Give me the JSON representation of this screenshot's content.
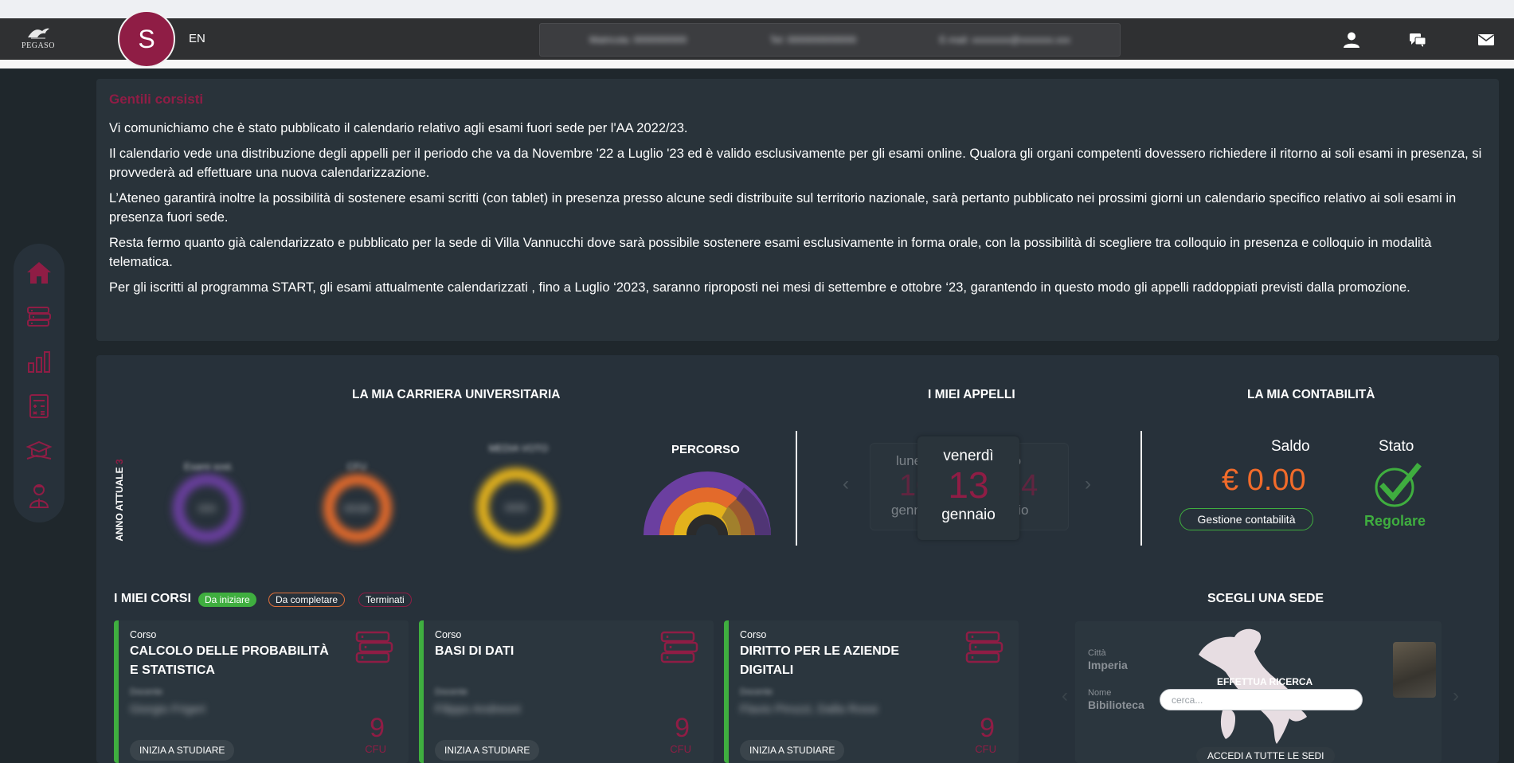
{
  "topbar": {
    "logo_text": "PEGASO",
    "avatar_initial": "S",
    "language": "EN",
    "contacts": [
      "Matricola: 0000000000",
      "Tel: 0000000000000",
      "E-mail: xxxxxxxx@xxxxxxx.xxx"
    ],
    "icons": [
      "user-icon",
      "chat-icon",
      "mail-icon"
    ]
  },
  "notice": {
    "title": "Gentili corsisti",
    "paragraphs": [
      "Vi comunichiamo che è stato pubblicato il calendario relativo agli esami fuori sede per l'AA 2022/23.",
      "Il calendario vede una distribuzione degli appelli per il periodo che va da Novembre '22 a Luglio '23 ed è valido esclusivamente per gli esami online. Qualora gli organi competenti dovessero richiedere il ritorno ai soli esami in presenza, si provvederà ad effettuare una nuova calendarizzazione.",
      "L’Ateneo garantirà inoltre la possibilità di sostenere esami scritti (con tablet) in presenza presso alcune sedi distribuite sul territorio nazionale, sarà pertanto pubblicato nei prossimi giorni un calendario specifico relativo ai soli esami in presenza fuori sede.",
      "Resta fermo quanto già calendarizzato e pubblicato per la sede di Villa Vannucchi dove sarà possibile sostenere esami esclusivamente in forma orale, con la possibilità di scegliere tra colloquio in presenza e colloquio in modalità telematica.",
      "Per gli iscritti al programma START, gli esami attualmente calendarizzati , fino a Luglio ‘2023, saranno riproposti nei mesi di settembre e ottobre ‘23, garantendo in questo modo gli appelli raddoppiati previsti dalla promozione."
    ]
  },
  "sidebar": {
    "items": [
      "home-icon",
      "books-icon",
      "stats-icon",
      "calculator-icon",
      "graduation-icon",
      "tutor-icon"
    ],
    "accent": "#8f1d45"
  },
  "carriera": {
    "title": "LA MIA CARRIERA UNIVERSITARIA",
    "anno_label": "ANNO ATTUALE",
    "anno_value": "3",
    "donuts": [
      {
        "label": "Esami sost.",
        "value": "0/24",
        "color": "#6b3fa0"
      },
      {
        "label": "CFU",
        "value": "00/180",
        "color": "#e36a2b"
      },
      {
        "label": "MEDIA VOTO",
        "value": "00/30",
        "color": "#e3b21c"
      }
    ],
    "percorso_title": "PERCORSO"
  },
  "appelli": {
    "title": "I MIEI APPELLI",
    "prev": {
      "dow": "lunedì",
      "day": "10",
      "month": "gennaio"
    },
    "current": {
      "dow": "venerdì",
      "day": "13",
      "month": "gennaio"
    },
    "next": {
      "dow": "sabato",
      "day": "14",
      "month": "gennaio"
    }
  },
  "contabilita": {
    "title": "LA MIA CONTABILITÀ",
    "saldo_label": "Saldo",
    "saldo_value": "€ 0.00",
    "gestione_button": "Gestione contabilità",
    "stato_label": "Stato",
    "stato_value": "Regolare"
  },
  "corsi": {
    "title": "I MIEI CORSI",
    "filters": [
      "Da iniziare",
      "Da completare",
      "Terminati"
    ],
    "items": [
      {
        "label": "Corso",
        "name": "CALCOLO DELLE PROBABILITÀ E STATISTICA",
        "docente_label": "Docente",
        "docente": "Giorgio Frigeri",
        "cfu": "9",
        "cfu_label": "CFU",
        "button": "INIZIA A STUDIARE"
      },
      {
        "label": "Corso",
        "name": "BASI DI DATI",
        "docente_label": "Docente",
        "docente": "Filippo Andreoni",
        "cfu": "9",
        "cfu_label": "CFU",
        "button": "INIZIA A STUDIARE"
      },
      {
        "label": "Corso",
        "name": "DIRITTO PER LE AZIENDE DIGITALI",
        "docente_label": "Docente",
        "docente": "Flavio Pirozzi, Dalla Rossi",
        "cfu": "9",
        "cfu_label": "CFU",
        "button": "INIZIA A STUDIARE"
      }
    ]
  },
  "sede": {
    "title": "SCEGLI UNA SEDE",
    "citta_label": "Città",
    "citta_value": "Imperia",
    "nome_label": "Nome",
    "nome_value": "Bibilioteca",
    "search_title": "EFFETTUA RICERCA",
    "search_placeholder": "cerca...",
    "accedi_button": "ACCEDI A TUTTE LE SEDI"
  }
}
